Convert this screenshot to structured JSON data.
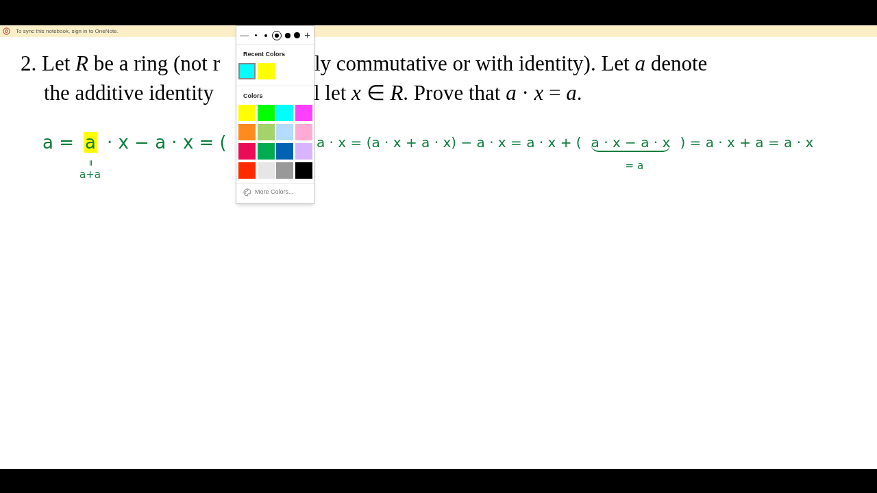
{
  "notification": {
    "text": "To sync this notebook, sign in to OneNote."
  },
  "problem": {
    "lines": [
      {
        "left": "2. Let *R* be a ring (not r",
        "right": "ly commutative or with identity).  Let *a* denote"
      },
      {
        "left": "the additive identity",
        "right": "l let *x* ∈ *R*.  Prove that *a* · *x* = *a*."
      }
    ]
  },
  "ink": {
    "color": "#0c7d3c",
    "left": [
      {
        "text": "a =",
        "highlighted": false
      },
      {
        "text": "a",
        "highlighted": true,
        "note_mark": "=",
        "note": "a+a"
      },
      {
        "text": "· x − a · x = (",
        "highlighted": false
      }
    ],
    "right": [
      {
        "text": "a · x = (a · x + a · x) − a · x = a · x + (",
        "underlined": false
      },
      {
        "text": "a · x − a · x",
        "underlined": true,
        "note": "= a"
      },
      {
        "text": ") = a · x + a = a · x",
        "underlined": false
      }
    ]
  },
  "pen_menu": {
    "decrease": "—",
    "increase": "+",
    "sizes": [
      {
        "selected": false
      },
      {
        "selected": false
      },
      {
        "selected": true
      },
      {
        "selected": false
      },
      {
        "selected": false
      }
    ],
    "recent_title": "Recent Colors",
    "recent": [
      {
        "color": "#00ffff",
        "selected": true
      },
      {
        "color": "#ffff00",
        "selected": false
      }
    ],
    "colors_title": "Colors",
    "colors": [
      {
        "color": "#ffff00",
        "selected": false
      },
      {
        "color": "#00ff00",
        "selected": false
      },
      {
        "color": "#00ffff",
        "selected": false
      },
      {
        "color": "#ff40ff",
        "selected": false
      },
      {
        "color": "#ff8a1e",
        "selected": false
      },
      {
        "color": "#a3d36a",
        "selected": false
      },
      {
        "color": "#b3dcff",
        "selected": false
      },
      {
        "color": "#ffabd6",
        "selected": false
      },
      {
        "color": "#eb0c58",
        "selected": false
      },
      {
        "color": "#00ac50",
        "selected": false
      },
      {
        "color": "#0062b1",
        "selected": false
      },
      {
        "color": "#d8b4fe",
        "selected": false
      },
      {
        "color": "#ff2a00",
        "selected": false
      },
      {
        "color": "#e6e6e6",
        "selected": false
      },
      {
        "color": "#999999",
        "selected": false
      },
      {
        "color": "#000000",
        "selected": false
      }
    ],
    "more": "More Colors..."
  }
}
